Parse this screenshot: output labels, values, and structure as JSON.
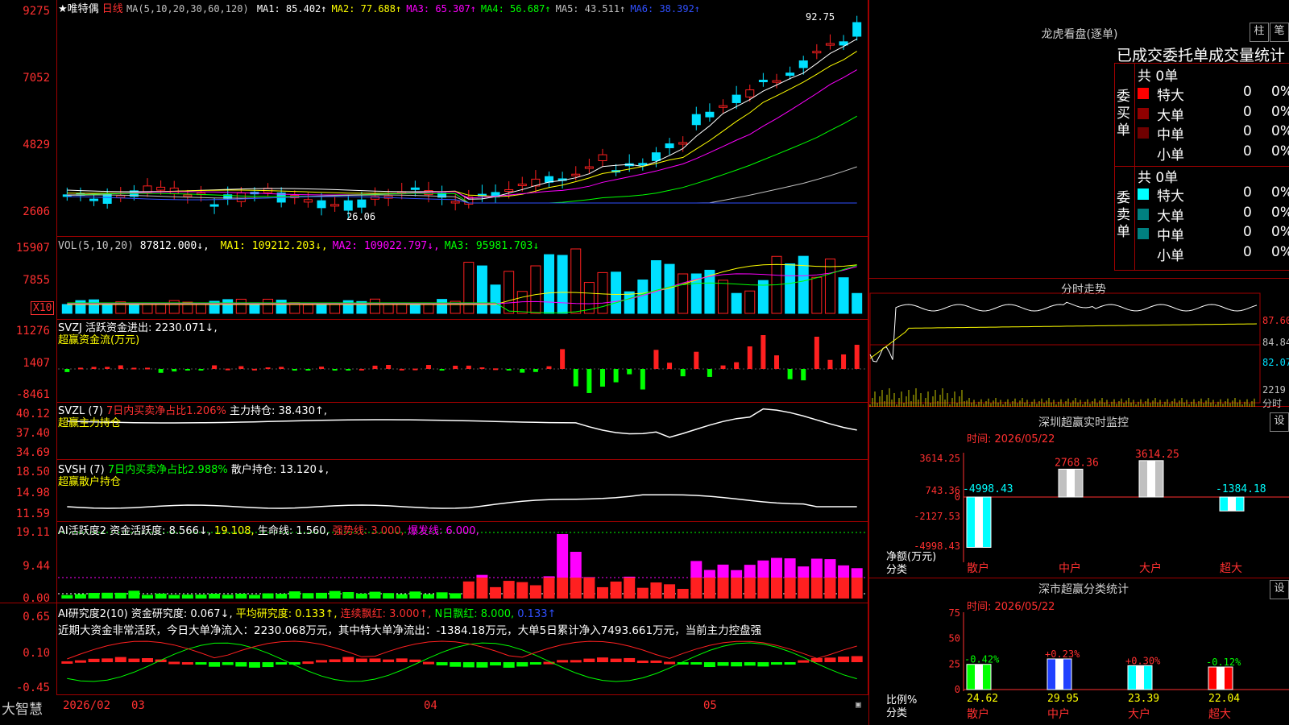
{
  "main": {
    "title": "★唯特偶",
    "period": "日线",
    "ma_label": "MA(5,10,20,30,60,120)",
    "ma": [
      {
        "label": "MA1: 85.402↑",
        "color": "#ffffff"
      },
      {
        "label": "MA2: 77.688↑",
        "color": "#ffff00"
      },
      {
        "label": "MA3: 65.307↑",
        "color": "#ff00ff"
      },
      {
        "label": "MA4: 56.687↑",
        "color": "#00ff00"
      },
      {
        "label": "MA5: 43.511↑",
        "color": "#c0c0c0"
      },
      {
        "label": "MA6: 38.392↑",
        "color": "#3050ff"
      }
    ],
    "y_ticks": [
      "9275",
      "7052",
      "4829",
      "2606"
    ],
    "high_label": "92.75",
    "low_label": "26.06"
  },
  "vol": {
    "label": "VOL(5,10,20)",
    "value": "87812.000↓,",
    "ma": [
      {
        "label": "MA1: 109212.203↓,",
        "color": "#ffff00"
      },
      {
        "label": "MA2: 109022.797↓,",
        "color": "#ff00ff"
      },
      {
        "label": "MA3: 95981.703↓",
        "color": "#00ff00"
      }
    ],
    "y_ticks": [
      "15907",
      "7855"
    ],
    "unit": "X10"
  },
  "svzj": {
    "label": "SVZJ  活跃资金进出: 2230.071↓,",
    "sub": "超赢资金流(万元)",
    "y_ticks": [
      "11276",
      "1407",
      "-8461"
    ]
  },
  "svzl": {
    "label": "SVZL (7)",
    "mid": "7日内买卖净占比1.206%",
    "tail": "主力持仓: 38.430↑,",
    "sub": "超赢主力持仓",
    "y_ticks": [
      "40.12",
      "37.40",
      "34.69"
    ]
  },
  "svsh": {
    "label": "SVSH (7)",
    "mid": "7日内买卖净占比2.988%",
    "tail": "散户持仓: 13.120↓,",
    "sub": "超赢散户持仓",
    "y_ticks": [
      "18.50",
      "14.98",
      "11.59"
    ]
  },
  "ai1": {
    "label": "AI活跃度2",
    "p1": "资金活跃度: 8.566↓,",
    "p2": "19.108,",
    "p3": "生命线: 1.560,",
    "p4": "强势线: 3.000,",
    "p5": "爆发线: 6.000,",
    "y_ticks": [
      "19.11",
      "9.44",
      "0.00"
    ]
  },
  "ai2": {
    "label": "AI研究度2(10)",
    "p1": "资金研究度: 0.067↓,",
    "p2": "平均研究度: 0.133↑,",
    "p3": "连续飘红: 3.000↑,",
    "p4": "N日飘红: 8.000,",
    "p5": "0.133↑",
    "desc": "近期大资金非常活跃，今日大单净流入：2230.068万元，其中特大单净流出：-1384.18万元，大单5日累计净入7493.661万元，当前主力控盘强",
    "y_ticks": [
      "0.65",
      "0.10",
      "-0.45"
    ]
  },
  "bottom": {
    "brand": "大智慧",
    "dates": [
      "2026/02",
      "03",
      "04",
      "05"
    ]
  },
  "dragon": {
    "title": "龙虎看盘(逐单)",
    "btn1": "柱",
    "btn2": "笔",
    "header": "已成交委托单成交量统计",
    "buy_label": "委买单",
    "sell_label": "委卖单",
    "buy_total": "共 0单",
    "sell_total": "共 0单",
    "buy_rows": [
      {
        "name": "特大",
        "count": "0",
        "pct": "0%",
        "color": "#ff0000"
      },
      {
        "name": "大单",
        "count": "0",
        "pct": "0%",
        "color": "#900000"
      },
      {
        "name": "中单",
        "count": "0",
        "pct": "0%",
        "color": "#700000"
      },
      {
        "name": "小单",
        "count": "0",
        "pct": "0%",
        "color": ""
      }
    ],
    "sell_rows": [
      {
        "name": "特大",
        "count": "0",
        "pct": "0%",
        "color": "#00ffff"
      },
      {
        "name": "大单",
        "count": "0",
        "pct": "0%",
        "color": "#008080"
      },
      {
        "name": "中单",
        "count": "0",
        "pct": "0%",
        "color": "#008080"
      },
      {
        "name": "小单",
        "count": "0",
        "pct": "0%",
        "color": ""
      }
    ]
  },
  "intraday": {
    "title": "分时走势",
    "prices": [
      "87.60",
      "84.84",
      "82.07"
    ],
    "vol_label": "2219",
    "vol_unit": "分时"
  },
  "monitor": {
    "title": "深圳超赢实时监控",
    "btn": "设",
    "time": "时间: 2026/05/22",
    "y_ticks": [
      "3614.25",
      "743.36",
      "0",
      "-2127.53",
      "-4998.43"
    ],
    "ylabel": "净额(万元)",
    "xlabel": "分类",
    "bars": [
      {
        "cat": "散户",
        "value": -4998.43,
        "label": "-4998.43",
        "color": "#00ffff",
        "lc": "#00ffff"
      },
      {
        "cat": "中户",
        "value": 2768.36,
        "label": "2768.36",
        "color": "#c0c0c0",
        "lc": "#ff3030"
      },
      {
        "cat": "大户",
        "value": 3614.25,
        "label": "3614.25",
        "color": "#c0c0c0",
        "lc": "#ff3030"
      },
      {
        "cat": "超大",
        "value": -1384.18,
        "label": "-1384.18",
        "color": "#00ffff",
        "lc": "#00ffff"
      }
    ]
  },
  "stat": {
    "title": "深市超赢分类统计",
    "btn": "设",
    "time": "时间: 2026/05/22",
    "y_ticks": [
      "75",
      "50",
      "25",
      "0"
    ],
    "ylabel": "比例%",
    "xlabel": "分类",
    "bars": [
      {
        "cat": "散户",
        "value": 24.62,
        "label": "24.62",
        "chg": "-0.42%",
        "color": "#00ff00",
        "lc": "#00ff00"
      },
      {
        "cat": "中户",
        "value": 29.95,
        "label": "29.95",
        "chg": "+0.23%",
        "color": "#2040ff",
        "lc": "#ff3030"
      },
      {
        "cat": "大户",
        "value": 23.39,
        "label": "23.39",
        "chg": "+0.30%",
        "color": "#00ffff",
        "lc": "#ff3030"
      },
      {
        "cat": "超大",
        "value": 22.04,
        "label": "22.04",
        "chg": "-0.12%",
        "color": "#ff0000",
        "lc": "#00ff00"
      }
    ]
  },
  "colors": {
    "up": "#ff2020",
    "down": "#00e0ff",
    "grid": "#a00000",
    "green": "#00ff00",
    "yellow": "#ffff00",
    "magenta": "#ff00ff"
  }
}
